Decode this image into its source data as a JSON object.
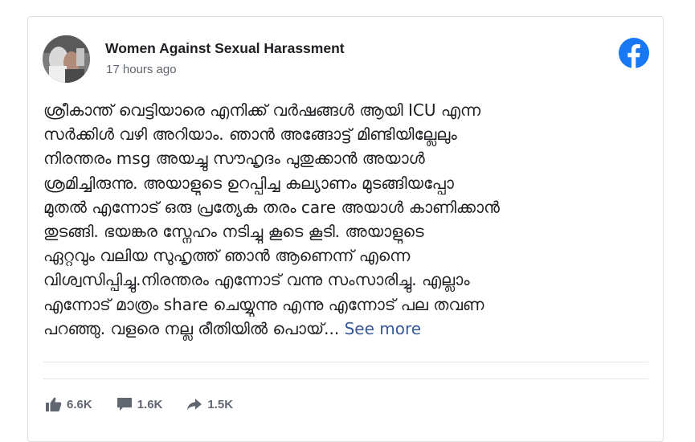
{
  "post": {
    "page_name": "Women Against Sexual Harassment",
    "timestamp": "17 hours ago",
    "avatar_icon": "page-avatar-photo",
    "brand_icon": "facebook-icon",
    "text_lines": [
      "ശ്രീകാന്ത് വെട്ടിയാരെ എനിക്ക് വർഷങ്ങൾ ആയി ICU എന്ന",
      "സർക്കിൾ വഴി അറിയാം. ഞാൻ അങ്ങോട്ട് മിണ്ടിയില്ലേലും",
      "നിരന്തരം msg അയച്ചു സൗഹൃദം പുതുക്കാൻ അയാൾ",
      "ശ്രമിച്ചിരുന്നു. അയാളുടെ ഉറപ്പിച്ച കല്യാണം മുടങ്ങിയപ്പോ",
      "മുതൽ എന്നോട് ഒരു പ്രത്യേക തരം care അയാൾ കാണിക്കാൻ",
      "തുടങ്ങി. ഭയങ്കര സ്നേഹം നടിച്ചു കൂടെ കൂടി. അയാളുടെ",
      "ഏറ്റവും വലിയ സുഹൃത്ത് ഞാൻ ആണെന്ന് എന്നെ",
      "വിശ്വസിപ്പിച്ചു.നിരന്തരം എന്നോട് വന്നു സംസാരിച്ചു. എല്ലാം",
      "എന്നോട് മാത്രം share ചെയ്യുന്നു എന്നു എന്നോട് പല തവണ",
      "പറഞ്ഞു. വളരെ നല്ല രീതിയിൽ പൊയ്..."
    ],
    "see_more_label": "See more"
  },
  "stats": {
    "likes": {
      "icon": "like-thumb-icon",
      "count": "6.6K"
    },
    "comments": {
      "icon": "comment-bubble-icon",
      "count": "1.6K"
    },
    "shares": {
      "icon": "share-arrow-icon",
      "count": "1.5K"
    }
  },
  "colors": {
    "facebook_blue": "#1877f2",
    "link": "#385898",
    "meta_text": "#616770",
    "action_gray": "#606770",
    "border": "#dddfe2"
  }
}
